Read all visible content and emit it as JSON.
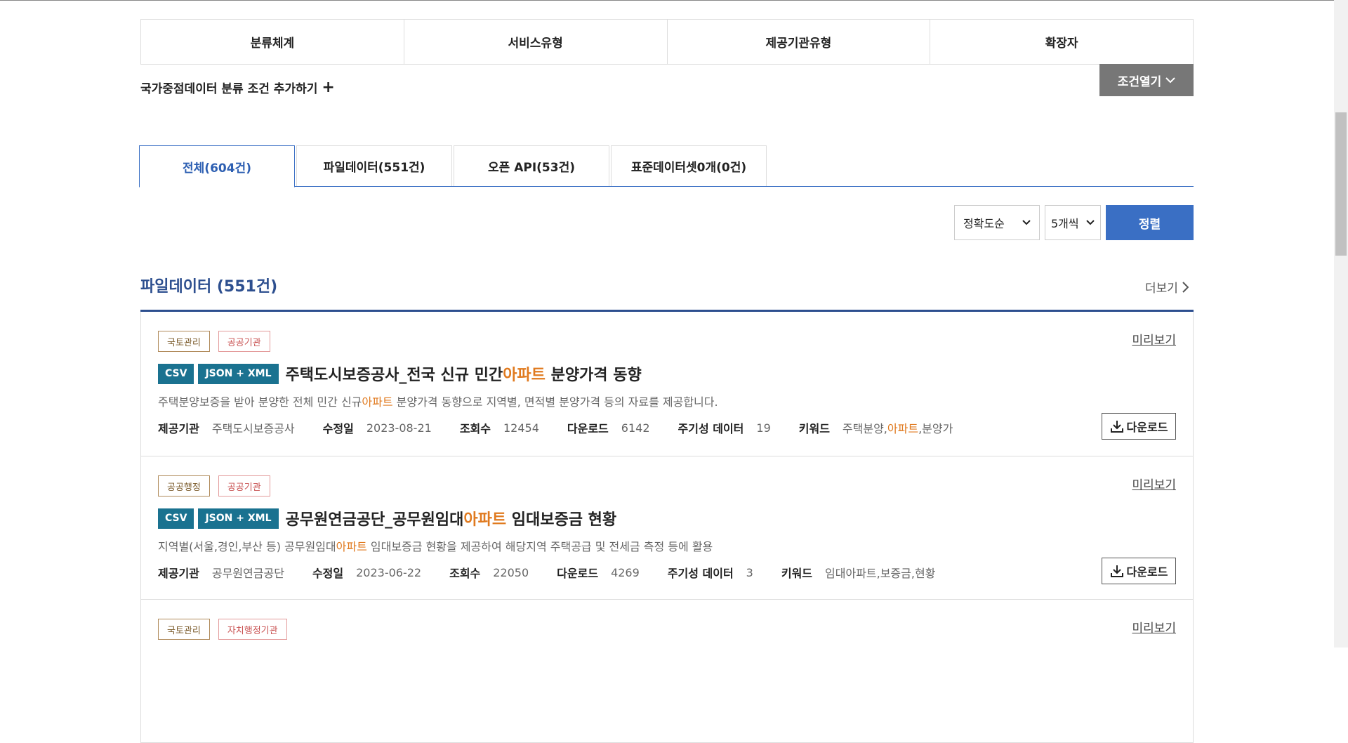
{
  "filter_tabs": [
    "분류체계",
    "서비스유형",
    "제공기관유형",
    "확장자"
  ],
  "add_condition_label": "국가중점데이터 분류 조건 추가하기",
  "open_condition_label": "조건열기",
  "tabs": [
    {
      "label": "전체(604건)",
      "active": true
    },
    {
      "label": "파일데이터(551건)",
      "active": false
    },
    {
      "label": "오픈 API(53건)",
      "active": false
    },
    {
      "label": "표준데이터셋0개(0건)",
      "active": false
    }
  ],
  "sort": {
    "order": "정확도순",
    "per_page": "5개씩",
    "button": "정렬"
  },
  "section": {
    "title": "파일데이터 (551건)",
    "more": "더보기"
  },
  "labels": {
    "preview": "미리보기",
    "download": "다운로드",
    "provider": "제공기관",
    "modified": "수정일",
    "views": "조회수",
    "downloads": "다운로드",
    "periodic": "주기성 데이터",
    "keywords": "키워드"
  },
  "items": [
    {
      "badges": [
        "국토관리",
        "공공기관"
      ],
      "formats": [
        "CSV",
        "JSON + XML"
      ],
      "title_pre": "주택도시보증공사_전국 신규 민간",
      "title_hl": "아파트",
      "title_post": " 분양가격 동향",
      "desc_pre": "주택분양보증을 받아 분양한 전체 민간 신규",
      "desc_hl": "아파트",
      "desc_post": " 분양가격 동향으로 지역별, 면적별 분양가격 등의 자료를 제공합니다.",
      "provider": "주택도시보증공사",
      "modified": "2023-08-21",
      "views": "12454",
      "downloads": "6142",
      "periodic": "19",
      "kw_pre": "주택분양,",
      "kw_hl": "아파트",
      "kw_post": ",분양가"
    },
    {
      "badges": [
        "공공행정",
        "공공기관"
      ],
      "formats": [
        "CSV",
        "JSON + XML"
      ],
      "title_pre": "공무원연금공단_공무원임대",
      "title_hl": "아파트",
      "title_post": " 임대보증금 현황",
      "desc_pre": "지역별(서울,경인,부산 등) 공무원임대",
      "desc_hl": "아파트",
      "desc_post": " 임대보증금 현황을 제공하여 해당지역 주택공급 및 전세금 측정 등에 활용",
      "provider": "공무원연금공단",
      "modified": "2023-06-22",
      "views": "22050",
      "downloads": "4269",
      "periodic": "3",
      "kw_pre": "임대아파트,보증금,현황",
      "kw_hl": "",
      "kw_post": ""
    },
    {
      "badges": [
        "국토관리",
        "자치행정기관"
      ]
    }
  ]
}
